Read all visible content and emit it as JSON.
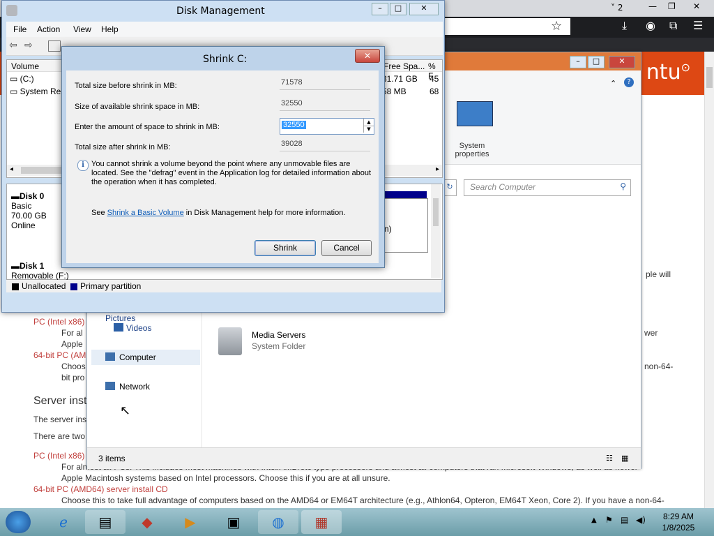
{
  "browser": {
    "tab_count": "2",
    "window_controls": {
      "minimize": "—",
      "maximize": "❐",
      "close": "✕"
    },
    "toolbar_icons": [
      "star-icon",
      "download-icon",
      "account-icon",
      "extensions-icon",
      "menu-icon"
    ]
  },
  "webpage": {
    "logo_text": "ntu",
    "lines": {
      "pc_intel_1": "PC (Intel x86)",
      "for_al_1": "For al",
      "apple_1": "Apple",
      "amd64_1": "64-bit PC (AMD",
      "choose_1": "Choos",
      "bit_pro": "bit pro",
      "server_heading": "Server inst",
      "server_text": "The server ins",
      "there_are": "There are two",
      "pc_intel_2": "PC (Intel x86)",
      "for_al_2": "For almost all PCs. This includes most machines with Intel/AMD/etc type processors and almost all computers that run Microsoft Windows, as well as newer",
      "apple_2": "Apple Macintosh systems based on Intel processors. Choose this if you are at all unsure.",
      "amd64_2": "64-bit PC (AMD64) server install CD",
      "choose_2": "Choose this to take full advantage of computers based on the AMD64 or EM64T architecture (e.g., Athlon64, Opteron, EM64T Xeon, Core 2). If you have a non-64-",
      "right_ple_will": "ple will",
      "right_newer": "wer",
      "right_non64": "non-64-"
    }
  },
  "explorer": {
    "ribbon": {
      "system_properties": "System\nproperties",
      "system_properties_line1": "System",
      "system_properties_line2": "properties"
    },
    "search_placeholder": "Search Computer",
    "nav": {
      "pictures": "Pictures",
      "videos": "Videos",
      "computer": "Computer",
      "network": "Network"
    },
    "main": {
      "media_servers": "Media Servers",
      "system_folder": "System Folder"
    },
    "status_items": "3 items"
  },
  "disk_management": {
    "title": "Disk Management",
    "menu": [
      "File",
      "Action",
      "View",
      "Help"
    ],
    "columns": {
      "volume": "Volume",
      "free_space": "Free Spa...",
      "pct": "% F"
    },
    "volumes": [
      {
        "name": "(C:)",
        "free": "31.71 GB",
        "pct": "45"
      },
      {
        "name": "System Res",
        "free": "58 MB",
        "pct": "68"
      }
    ],
    "disks": [
      {
        "label": "Disk 0",
        "type": "Basic",
        "size": "70.00 GB",
        "status": "Online"
      },
      {
        "label": "Disk 1",
        "type": "Removable (F:)"
      }
    ],
    "partition_fragment": "n)",
    "legend": {
      "unallocated": "Unallocated",
      "primary": "Primary partition"
    },
    "colors": {
      "unallocated": "#000000",
      "primary": "#00008b"
    }
  },
  "shrink_dialog": {
    "title": "Shrink C:",
    "fields": {
      "total_before_label": "Total size before shrink in MB:",
      "total_before_value": "71578",
      "available_label": "Size of available shrink space in MB:",
      "available_value": "32550",
      "enter_label": "Enter the amount of space to shrink in MB:",
      "enter_value": "32550",
      "total_after_label": "Total size after shrink in MB:",
      "total_after_value": "39028"
    },
    "info_text": "You cannot shrink a volume beyond the point where any unmovable files are located. See the \"defrag\" event in the Application log for detailed information about the operation when it has completed.",
    "see_prefix": "See ",
    "see_link": "Shrink a Basic Volume",
    "see_suffix": " in Disk Management help for more information.",
    "shrink_button": "Shrink",
    "cancel_button": "Cancel",
    "close": "✕"
  },
  "taskbar": {
    "time": "8:29 AM",
    "date": "1/8/2025"
  }
}
